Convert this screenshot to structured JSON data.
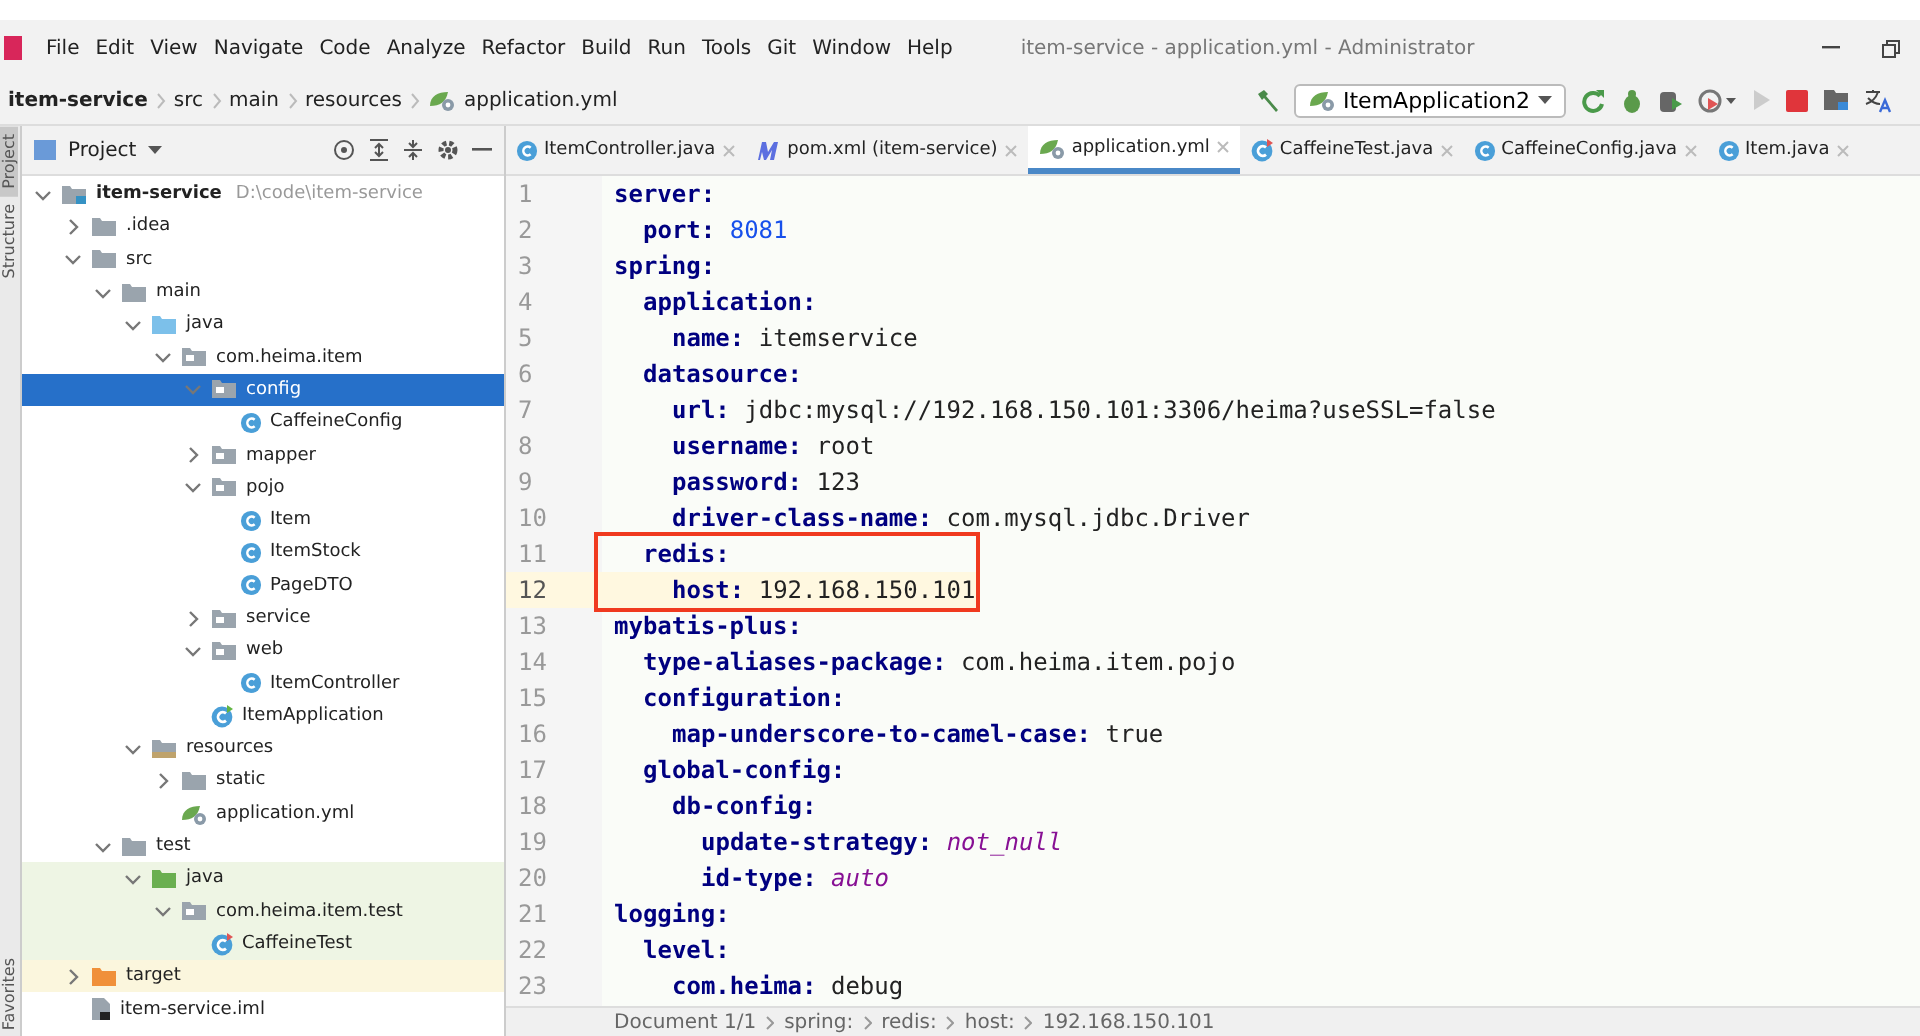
{
  "window": {
    "title": "item-service - application.yml - Administrator"
  },
  "menu": [
    "File",
    "Edit",
    "View",
    "Navigate",
    "Code",
    "Analyze",
    "Refactor",
    "Build",
    "Run",
    "Tools",
    "Git",
    "Window",
    "Help"
  ],
  "breadcrumb": [
    "item-service",
    "src",
    "main",
    "resources",
    "application.yml"
  ],
  "run_config": "ItemApplication2",
  "side_stripe": [
    {
      "label": "Project",
      "selected": true
    },
    {
      "label": "Structure",
      "selected": false
    },
    {
      "label": "Favorites",
      "selected": false
    }
  ],
  "project_panel": {
    "title": "Project",
    "tree": [
      {
        "name": "item-service",
        "path": "D:\\code\\item-service",
        "kind": "module",
        "expanded": true,
        "selected": false,
        "children": [
          {
            "name": ".idea",
            "kind": "folder",
            "expanded": false,
            "selected": false,
            "excluded": false
          },
          {
            "name": "src",
            "kind": "folder",
            "expanded": true,
            "selected": false,
            "excluded": false,
            "children": [
              {
                "name": "main",
                "kind": "folder",
                "expanded": true,
                "selected": false,
                "children": [
                  {
                    "name": "java",
                    "kind": "source-folder",
                    "expanded": true,
                    "selected": false,
                    "children": [
                      {
                        "name": "com.heima.item",
                        "kind": "package",
                        "expanded": true,
                        "selected": false,
                        "children": [
                          {
                            "name": "config",
                            "kind": "package",
                            "expanded": true,
                            "selected": true,
                            "children": [
                              {
                                "name": "CaffeineConfig",
                                "kind": "class",
                                "selected": false
                              }
                            ]
                          },
                          {
                            "name": "mapper",
                            "kind": "package",
                            "expanded": false,
                            "selected": false
                          },
                          {
                            "name": "pojo",
                            "kind": "package",
                            "expanded": true,
                            "selected": false,
                            "children": [
                              {
                                "name": "Item",
                                "kind": "class",
                                "selected": false
                              },
                              {
                                "name": "ItemStock",
                                "kind": "class",
                                "selected": false
                              },
                              {
                                "name": "PageDTO",
                                "kind": "class",
                                "selected": false
                              }
                            ]
                          },
                          {
                            "name": "service",
                            "kind": "package",
                            "expanded": false,
                            "selected": false
                          },
                          {
                            "name": "web",
                            "kind": "package",
                            "expanded": true,
                            "selected": false,
                            "children": [
                              {
                                "name": "ItemController",
                                "kind": "class",
                                "selected": false
                              }
                            ]
                          },
                          {
                            "name": "ItemApplication",
                            "kind": "app-class",
                            "selected": false
                          }
                        ]
                      }
                    ]
                  },
                  {
                    "name": "resources",
                    "kind": "resource-folder",
                    "expanded": true,
                    "selected": false,
                    "children": [
                      {
                        "name": "static",
                        "kind": "folder",
                        "expanded": false,
                        "selected": false
                      },
                      {
                        "name": "application.yml",
                        "kind": "yaml",
                        "selected": false
                      }
                    ]
                  }
                ]
              },
              {
                "name": "test",
                "kind": "folder",
                "expanded": true,
                "selected": false,
                "children": [
                  {
                    "name": "java",
                    "kind": "test-folder",
                    "test_source": true,
                    "expanded": true,
                    "selected": false,
                    "children": [
                      {
                        "name": "com.heima.item.test",
                        "kind": "package",
                        "test_source": true,
                        "expanded": true,
                        "selected": false,
                        "children": [
                          {
                            "name": "CaffeineTest",
                            "kind": "test-class",
                            "test_source": true,
                            "selected": false
                          }
                        ]
                      }
                    ]
                  }
                ]
              }
            ]
          },
          {
            "name": "target",
            "kind": "excluded-folder",
            "excluded": true,
            "expanded": false,
            "selected": false
          },
          {
            "name": "item-service.iml",
            "kind": "iml",
            "excluded": false,
            "selected": false
          }
        ]
      }
    ]
  },
  "tabs": [
    {
      "label": "ItemController.java",
      "kind": "class",
      "selected": false
    },
    {
      "label": "pom.xml (item-service)",
      "kind": "maven",
      "selected": false
    },
    {
      "label": "application.yml",
      "kind": "yaml",
      "selected": true
    },
    {
      "label": "CaffeineTest.java",
      "kind": "test-class",
      "selected": false
    },
    {
      "label": "CaffeineConfig.java",
      "kind": "class",
      "selected": false
    },
    {
      "label": "Item.java",
      "kind": "class",
      "selected": false
    }
  ],
  "editor": {
    "lines": [
      {
        "line": "1",
        "key": "server:",
        "current": false,
        "boxed": false,
        "children": [
          {
            "line": "2",
            "key": "port:",
            "value": "8081",
            "kind": "number",
            "current": false,
            "boxed": false
          }
        ]
      },
      {
        "line": "3",
        "key": "spring:",
        "current": false,
        "boxed": false,
        "children": [
          {
            "line": "4",
            "key": "application:",
            "current": false,
            "boxed": false,
            "children": [
              {
                "line": "5",
                "key": "name:",
                "value": "itemservice",
                "current": false,
                "boxed": false
              }
            ]
          },
          {
            "line": "6",
            "key": "datasource:",
            "current": false,
            "boxed": false,
            "children": [
              {
                "line": "7",
                "key": "url:",
                "value": "jdbc:mysql://192.168.150.101:3306/heima?useSSL=false",
                "current": false,
                "boxed": false
              },
              {
                "line": "8",
                "key": "username:",
                "value": "root",
                "current": false,
                "boxed": false
              },
              {
                "line": "9",
                "key": "password:",
                "value": "123",
                "current": false,
                "boxed": false
              },
              {
                "line": "10",
                "key": "driver-class-name:",
                "value": "com.mysql.jdbc.Driver",
                "current": false,
                "boxed": false
              }
            ]
          },
          {
            "line": "11",
            "key": "redis:",
            "current": false,
            "boxed": true,
            "children": [
              {
                "line": "12",
                "key": "host:",
                "value": "192.168.150.101",
                "current": true,
                "boxed": true
              }
            ]
          }
        ]
      },
      {
        "line": "13",
        "key": "mybatis-plus:",
        "current": false,
        "boxed": false,
        "children": [
          {
            "line": "14",
            "key": "type-aliases-package:",
            "value": "com.heima.item.pojo",
            "current": false,
            "boxed": false
          },
          {
            "line": "15",
            "key": "configuration:",
            "current": false,
            "boxed": false,
            "children": [
              {
                "line": "16",
                "key": "map-underscore-to-camel-case:",
                "value": "true",
                "current": false,
                "boxed": false
              }
            ]
          },
          {
            "line": "17",
            "key": "global-config:",
            "current": false,
            "boxed": false,
            "children": [
              {
                "line": "18",
                "key": "db-config:",
                "current": false,
                "boxed": false,
                "children": [
                  {
                    "line": "19",
                    "key": "update-strategy:",
                    "value": "not_null",
                    "kind": "constant",
                    "current": false,
                    "boxed": false
                  },
                  {
                    "line": "20",
                    "key": "id-type:",
                    "value": "auto",
                    "kind": "constant",
                    "current": false,
                    "boxed": false
                  }
                ]
              }
            ]
          }
        ]
      },
      {
        "line": "21",
        "key": "logging:",
        "current": false,
        "boxed": false,
        "children": [
          {
            "line": "22",
            "key": "level:",
            "current": false,
            "boxed": false,
            "children": [
              {
                "line": "23",
                "key": "com.heima:",
                "value": "debug",
                "current": false,
                "boxed": false
              }
            ]
          }
        ]
      }
    ]
  },
  "status_path": [
    "Document 1/1",
    "spring:",
    "redis:",
    "host:",
    "192.168.150.101"
  ]
}
